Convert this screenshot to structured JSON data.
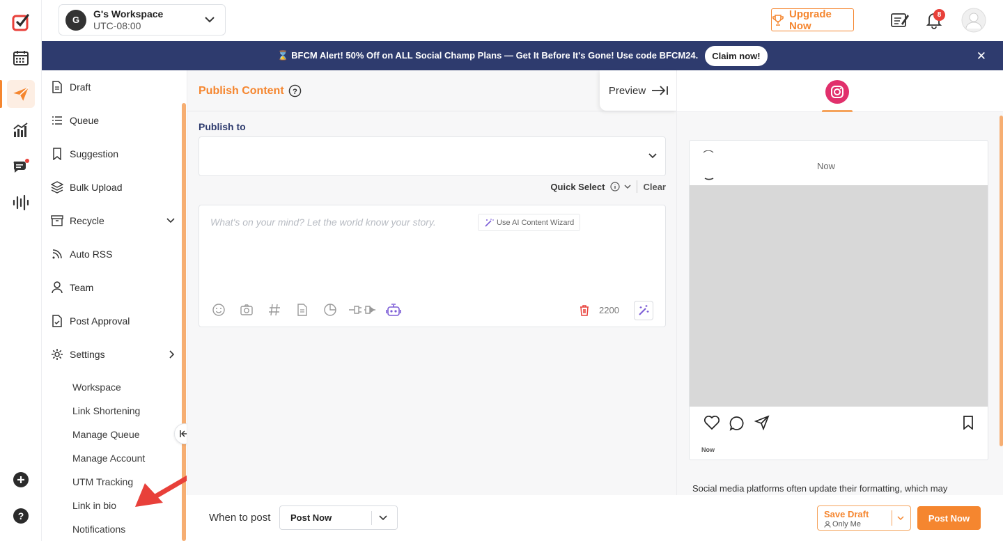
{
  "workspace": {
    "avatar": "G",
    "name": "G's Workspace",
    "timezone": "UTC-08:00"
  },
  "header": {
    "upgrade_label": "Upgrade Now",
    "notifications_count": "8"
  },
  "banner": {
    "text": "⌛ BFCM Alert! 50% Off on ALL Social Champ Plans — Get It Before It's Gone! Use code BFCM24.",
    "cta": "Claim now!",
    "close": "✕"
  },
  "sidebar": {
    "items": [
      {
        "label": "Draft",
        "icon": "draft-icon"
      },
      {
        "label": "Queue",
        "icon": "list-icon"
      },
      {
        "label": "Suggestion",
        "icon": "bookmark-icon"
      },
      {
        "label": "Bulk Upload",
        "icon": "layers-icon"
      },
      {
        "label": "Recycle",
        "icon": "archive-icon"
      },
      {
        "label": "Auto RSS",
        "icon": "rss-icon"
      },
      {
        "label": "Team",
        "icon": "user-icon"
      },
      {
        "label": "Post Approval",
        "icon": "approval-icon"
      },
      {
        "label": "Settings",
        "icon": "gear-icon"
      }
    ],
    "settings_sub": [
      "Workspace",
      "Link Shortening",
      "Manage Queue",
      "Manage Account",
      "UTM Tracking",
      "Link in bio",
      "Notifications"
    ]
  },
  "composer": {
    "title": "Publish Content",
    "preview_label": "Preview",
    "publish_to_label": "Publish to",
    "quick_select": "Quick Select",
    "clear": "Clear",
    "placeholder": "What's on your mind? Let the world know your story.",
    "ai_wizard": "Use AI Content Wizard",
    "char_count": "2200"
  },
  "preview": {
    "timestamp": "Now",
    "footer_time": "Now",
    "note": "Social media platforms often update their formatting, which may"
  },
  "bottom": {
    "when_label": "When to post",
    "when_value": "Post Now",
    "save_draft": "Save Draft",
    "save_draft_sub": "Only Me",
    "post_now": "Post Now"
  },
  "colors": {
    "accent": "#f5862f",
    "navy": "#2e3b6e",
    "instagram": "#e1306c"
  }
}
